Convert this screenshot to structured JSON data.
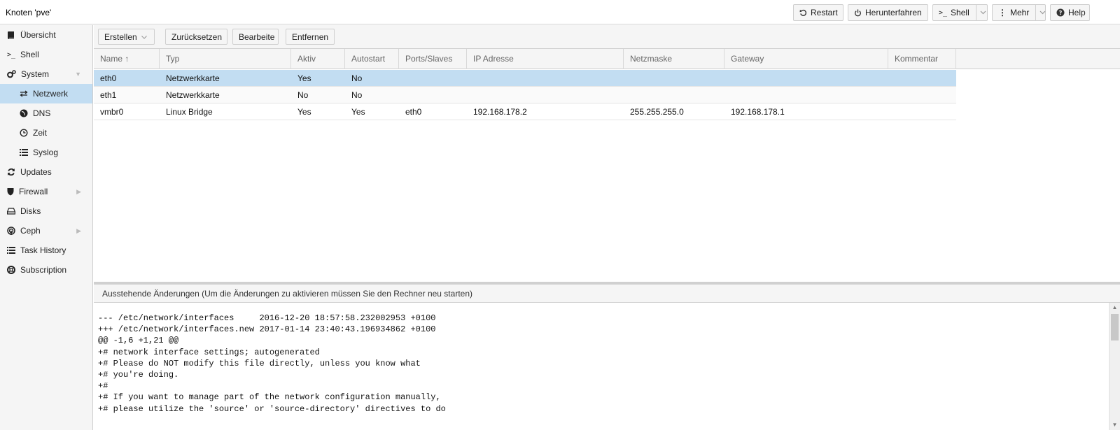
{
  "header": {
    "title": "Knoten 'pve'",
    "buttons": {
      "restart": "Restart",
      "shutdown": "Herunterfahren",
      "shell": "Shell",
      "more": "Mehr",
      "help": "Help"
    }
  },
  "sidebar": {
    "items": [
      {
        "label": "Übersicht",
        "icon": "book-icon"
      },
      {
        "label": "Shell",
        "icon": "terminal-icon"
      },
      {
        "label": "System",
        "icon": "cogs-icon"
      },
      {
        "label": "Netzwerk",
        "icon": "exchange-icon"
      },
      {
        "label": "DNS",
        "icon": "globe-icon"
      },
      {
        "label": "Zeit",
        "icon": "clock-icon"
      },
      {
        "label": "Syslog",
        "icon": "list-icon"
      },
      {
        "label": "Updates",
        "icon": "refresh-icon"
      },
      {
        "label": "Firewall",
        "icon": "shield-icon"
      },
      {
        "label": "Disks",
        "icon": "hdd-icon"
      },
      {
        "label": "Ceph",
        "icon": "ceph-icon"
      },
      {
        "label": "Task History",
        "icon": "list-icon"
      },
      {
        "label": "Subscription",
        "icon": "support-icon"
      }
    ]
  },
  "toolbar": {
    "create": "Erstellen",
    "revert": "Zurücksetzen",
    "edit": "Bearbeite",
    "remove": "Entfernen"
  },
  "grid": {
    "columns": [
      "Name ↑",
      "Typ",
      "Aktiv",
      "Autostart",
      "Ports/Slaves",
      "IP Adresse",
      "Netzmaske",
      "Gateway",
      "Kommentar"
    ],
    "rows": [
      [
        "eth0",
        "Netzwerkkarte",
        "Yes",
        "No",
        "",
        "",
        "",
        "",
        ""
      ],
      [
        "eth1",
        "Netzwerkkarte",
        "No",
        "No",
        "",
        "",
        "",
        "",
        ""
      ],
      [
        "vmbr0",
        "Linux Bridge",
        "Yes",
        "Yes",
        "eth0",
        "192.168.178.2",
        "255.255.255.0",
        "192.168.178.1",
        ""
      ]
    ]
  },
  "pending": {
    "title": "Ausstehende Änderungen (Um die Änderungen zu aktivieren müssen Sie den Rechner neu starten)",
    "lines": [
      "--- /etc/network/interfaces     2016-12-20 18:57:58.232002953 +0100",
      "+++ /etc/network/interfaces.new 2017-01-14 23:40:43.196934862 +0100",
      "@@ -1,6 +1,21 @@",
      "+# network interface settings; autogenerated",
      "+# Please do NOT modify this file directly, unless you know what",
      "+# you're doing.",
      "+#",
      "+# If you want to manage part of the network configuration manually,",
      "+# please utilize the 'source' or 'source-directory' directives to do"
    ]
  }
}
